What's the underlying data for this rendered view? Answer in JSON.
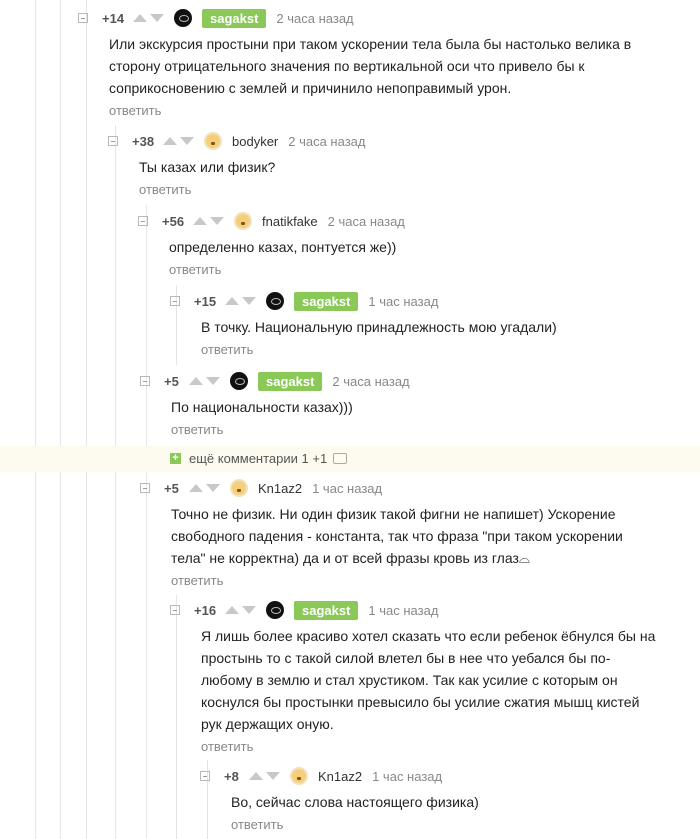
{
  "comments": [
    {
      "score": "+14",
      "nick": "sagakst",
      "op": true,
      "avatar": "dark-avatar",
      "time": "2 часа назад",
      "lines": [
        "Или экскурсия простыни при таком ускорении тела была бы настолько велика в",
        "сторону отрицательного значения по вертикальной оси что привело бы к",
        "соприкосновению с землей и причинило непоправимый урон."
      ],
      "reply": "ответить"
    },
    {
      "score": "+38",
      "nick": "bodyker",
      "op": false,
      "avatar": "yellow-avatar",
      "time": "2 часа назад",
      "lines": [
        "Ты казах или физик?"
      ],
      "reply": "ответить"
    },
    {
      "score": "+56",
      "nick": "fnatikfake",
      "op": false,
      "avatar": "yellow-avatar",
      "time": "2 часа назад",
      "lines": [
        "определенно казах, понтуется же))"
      ],
      "reply": "ответить"
    },
    {
      "score": "+15",
      "nick": "sagakst",
      "op": true,
      "avatar": "dark-avatar",
      "time": "1 час назад",
      "lines": [
        "В точку. Национальную принадлежность мою угадали)"
      ],
      "reply": "ответить"
    },
    {
      "score": "+5",
      "nick": "sagakst",
      "op": true,
      "avatar": "dark-avatar",
      "time": "2 часа назад",
      "lines": [
        "По национальности казах)))"
      ],
      "reply": "ответить"
    },
    {
      "score": "+5",
      "nick": "Kn1az2",
      "op": false,
      "avatar": "yellow-avatar",
      "time": "1 час назад",
      "lines": [
        "Точно не физик. Ни один физик такой фигни не напишет) Ускорение",
        "свободного падения - константа, так что фраза \"при таком ускорении",
        "тела\" не корректна) да и от всей фразы кровь из глаз⌓"
      ],
      "reply": "ответить"
    },
    {
      "score": "+16",
      "nick": "sagakst",
      "op": true,
      "avatar": "dark-avatar",
      "time": "1 час назад",
      "lines": [
        "Я лишь более красиво хотел сказать что если ребенок ёбнулся бы на",
        "простынь то с такой силой влетел бы в нее что уебался бы по-",
        "любому в землю и стал хрустиком. Так как усилие с которым он",
        "коснулся бы простынки превысило бы усилие сжатия мышц кистей",
        "рук держащих оную."
      ],
      "reply": "ответить"
    },
    {
      "score": "+8",
      "nick": "Kn1az2",
      "op": false,
      "avatar": "yellow-avatar",
      "time": "1 час назад",
      "lines": [
        "Во, сейчас слова настоящего физика)"
      ],
      "reply": "ответить"
    }
  ],
  "more_comments": {
    "label": "ещё комментарии 1 +1",
    "icon": "plus-icon",
    "bubble_icon": "comment-bubble-icon"
  }
}
